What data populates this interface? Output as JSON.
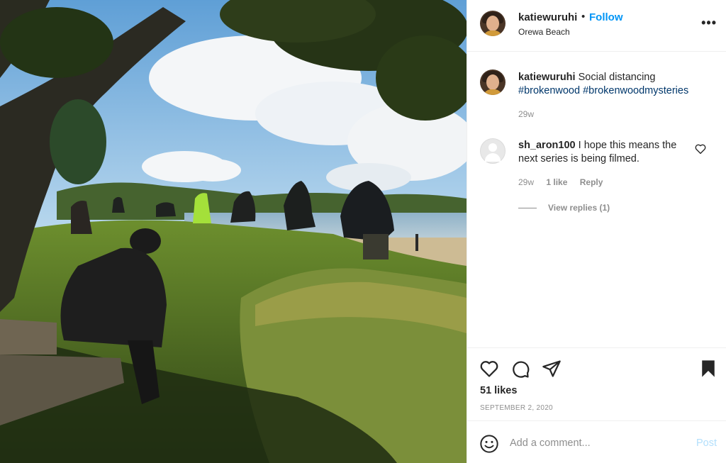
{
  "header": {
    "username": "katiewuruhi",
    "bullet": "•",
    "follow_label": "Follow",
    "location": "Orewa Beach",
    "more_label": "•••"
  },
  "caption": {
    "username": "katiewuruhi",
    "text": "Social distancing",
    "hashtags": [
      "#brokenwood",
      "#brokenwoodmysteries"
    ],
    "time": "29w"
  },
  "comments": [
    {
      "username": "sh_aron100",
      "text": "I hope this means the next series is being filmed.",
      "time": "29w",
      "likes": "1 like",
      "reply_label": "Reply",
      "view_replies": "View replies (1)"
    }
  ],
  "actions": {
    "icons": [
      "heart-icon",
      "comment-icon",
      "share-icon",
      "bookmark-icon"
    ],
    "likes": "51 likes",
    "date": "SEPTEMBER 2, 2020"
  },
  "add_comment": {
    "placeholder": "Add a comment...",
    "post_label": "Post"
  },
  "colors": {
    "link_blue": "#0095f6",
    "hashtag": "#00376b",
    "muted": "#8e8e8e",
    "post_disabled": "#b2dffc"
  }
}
